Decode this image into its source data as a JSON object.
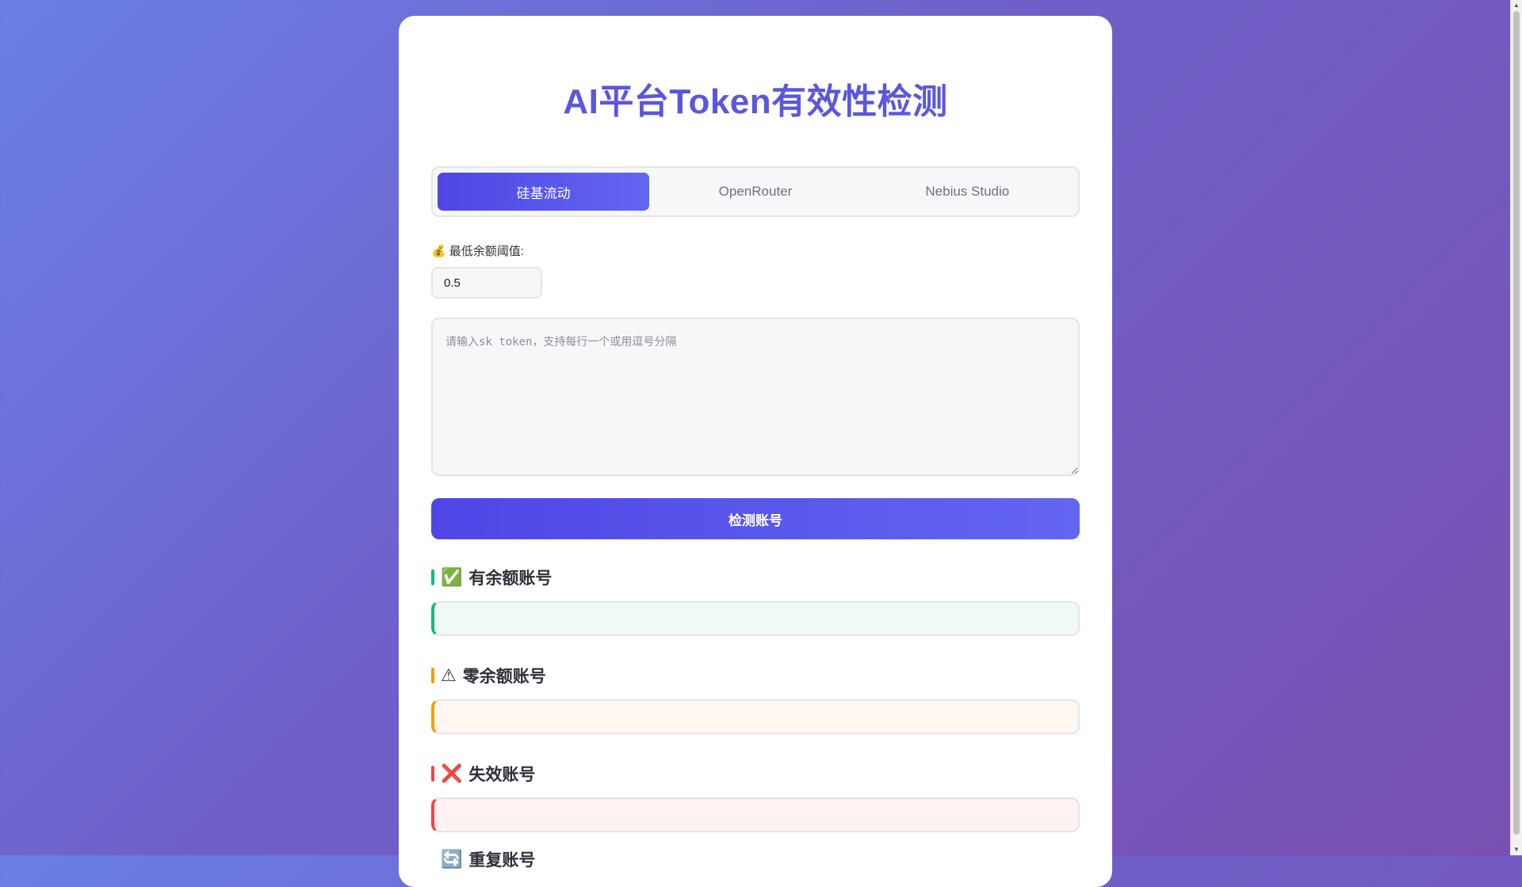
{
  "page": {
    "title": "AI平台Token有效性检测"
  },
  "tabs": [
    {
      "label": "硅基流动",
      "active": true
    },
    {
      "label": "OpenRouter",
      "active": false
    },
    {
      "label": "Nebius Studio",
      "active": false
    }
  ],
  "threshold": {
    "icon": "money-bag-icon",
    "icon_glyph": "💰",
    "label": "最低余额阈值:",
    "value": "0.5"
  },
  "token_input": {
    "placeholder": "请输入sk token，支持每行一个或用逗号分隔",
    "value": ""
  },
  "check_button": {
    "label": "检测账号"
  },
  "sections": {
    "valid": {
      "icon_glyph": "✅",
      "title": "有余额账号",
      "color": "#10b981"
    },
    "zero": {
      "icon_glyph": "⚠",
      "title": "零余额账号",
      "color": "#f59e0b"
    },
    "invalid": {
      "icon_glyph": "❌",
      "title": "失效账号",
      "color": "#ef4444"
    },
    "duplicate": {
      "icon_glyph": "🔄",
      "title": "重复账号",
      "color": "#3b82f6"
    }
  },
  "colors": {
    "accent": "#5b57dc",
    "button_gradient_start": "#4f46e5",
    "button_gradient_end": "#6366f1"
  }
}
